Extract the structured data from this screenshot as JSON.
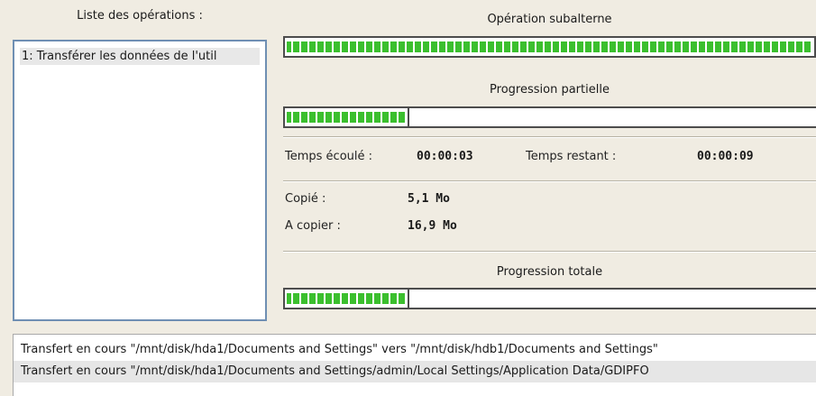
{
  "operations": {
    "title": "Liste des opérations :",
    "items": [
      "1: Transférer les données de l'util"
    ]
  },
  "sub_operation": {
    "title": "Opération subalterne",
    "progress": 1.0
  },
  "partial_progress": {
    "title": "Progression partielle",
    "progress": 0.235
  },
  "times": {
    "elapsed_label": "Temps écoulé :",
    "elapsed_value": "00:00:03",
    "remaining_label": "Temps restant :",
    "remaining_value": "00:00:09"
  },
  "sizes": {
    "copied_label": "Copié :",
    "copied_value": "5,1 Mo",
    "to_copy_label": "A copier :",
    "to_copy_value": "16,9 Mo"
  },
  "total_progress": {
    "title": "Progression totale",
    "progress": 0.235
  },
  "log": {
    "lines": [
      "Transfert en cours \"/mnt/disk/hda1/Documents and Settings\" vers \"/mnt/disk/hdb1/Documents and Settings\"",
      "Transfert en cours \"/mnt/disk/hda1/Documents and Settings/admin/Local Settings/Application Data/GDIPFO"
    ]
  },
  "colors": {
    "background": "#f0ece2",
    "progress_fill": "#3bbf2e",
    "list_border": "#6f8fb3"
  }
}
